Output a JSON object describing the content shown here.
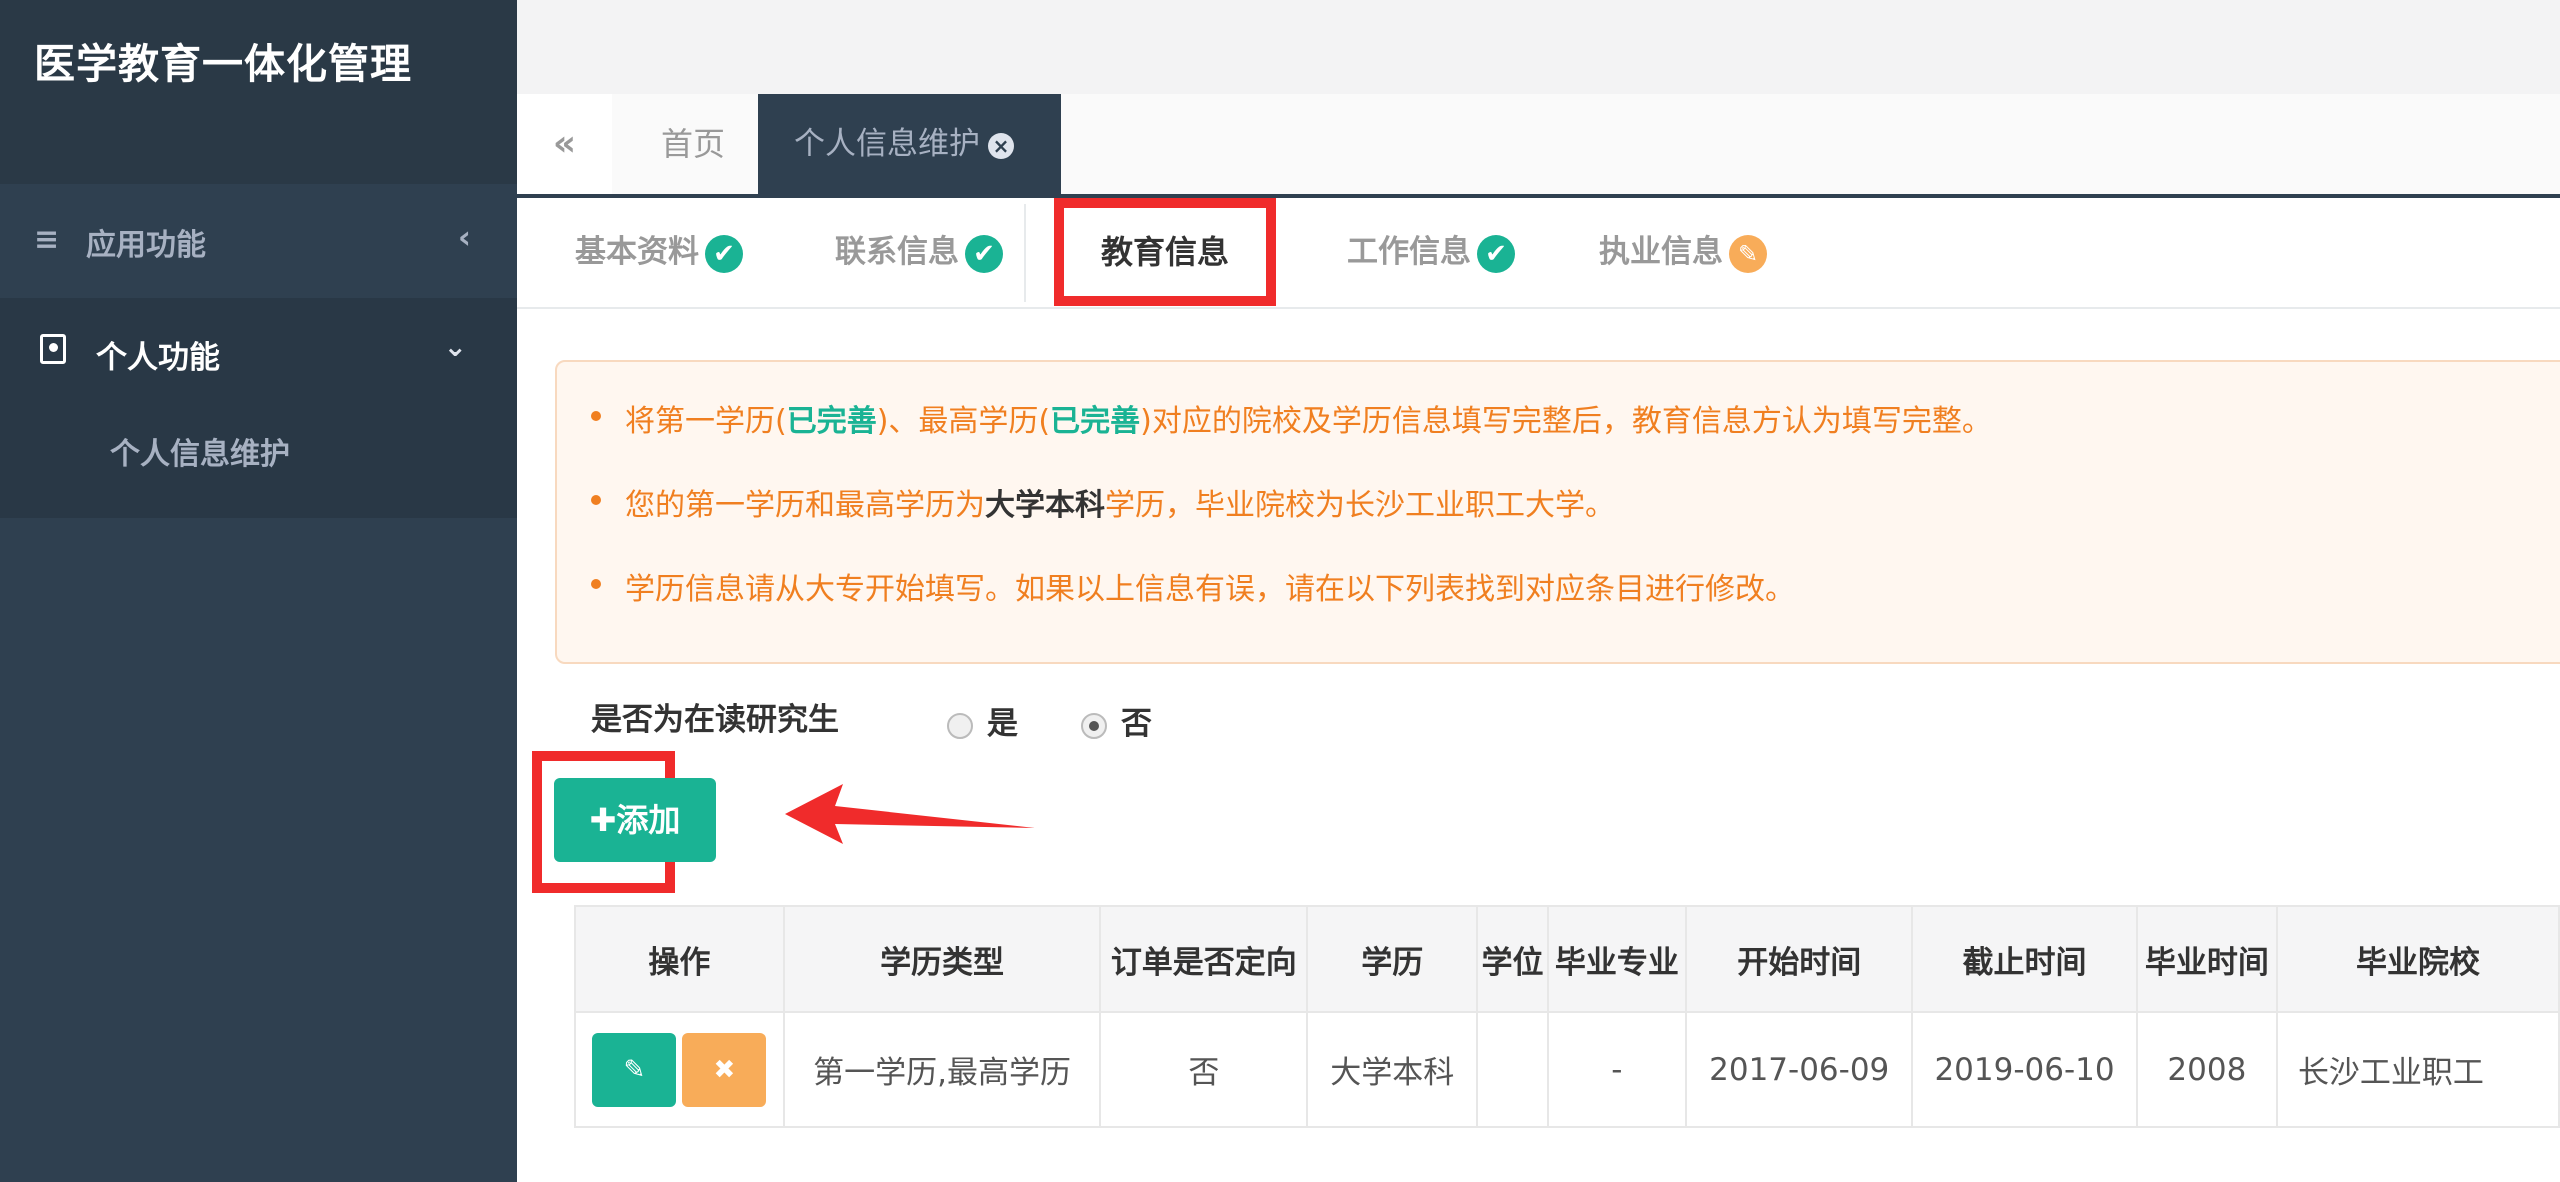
{
  "sidebar": {
    "brand": "医学教育一体化管理",
    "app_menu": {
      "label": "应用功能",
      "icon": "bars-icon",
      "chevron": "‹"
    },
    "personal_menu": {
      "label": "个人功能",
      "icon": "user-card-icon",
      "chevron": "⌄",
      "sub_items": [
        "个人信息维护"
      ]
    }
  },
  "tabs": {
    "back_icon": "«",
    "home": "首页",
    "active": "个人信息维护",
    "close_icon": "×"
  },
  "steps": [
    {
      "label": "基本资料",
      "status": "complete"
    },
    {
      "label": "联系信息",
      "status": "complete"
    },
    {
      "label": "教育信息",
      "status": "active"
    },
    {
      "label": "工作信息",
      "status": "complete"
    },
    {
      "label": "执业信息",
      "status": "edit"
    }
  ],
  "notice": {
    "line1": {
      "a": "将第一学历(",
      "b": "已完善",
      "c": ")、最高学历(",
      "d": "已完善",
      "e": ")对应的院校及学历信息填写完整后，教育信息方认为填写完整。"
    },
    "line2": {
      "a": "您的第一学历和最高学历为",
      "b": "大学本科",
      "c": "学历，毕业院校为长沙工业职工大学。"
    },
    "line3": "学历信息请从大专开始填写。如果以上信息有误，请在以下列表找到对应条目进行修改。"
  },
  "graduate_question": {
    "label": "是否为在读研究生",
    "options": [
      "是",
      "否"
    ],
    "selected": "否"
  },
  "add_button": "✚添加",
  "table": {
    "headers": [
      "操作",
      "学历类型",
      "订单是否定向",
      "学历",
      "学位",
      "毕业专业",
      "开始时间",
      "截止时间",
      "毕业时间",
      "毕业院校"
    ],
    "rows": [
      {
        "type": "第一学历,最高学历",
        "directed": "否",
        "education": "大学本科",
        "degree": "",
        "major": "-",
        "start": "2017-06-09",
        "end": "2019-06-10",
        "grad_year": "2008",
        "school": "长沙工业职工"
      }
    ]
  },
  "colors": {
    "sidebar": "#2f4050",
    "primary": "#1ab394",
    "warning": "#f8ac59",
    "highlight": "#f02b2b",
    "notice_text": "#f07f20"
  }
}
